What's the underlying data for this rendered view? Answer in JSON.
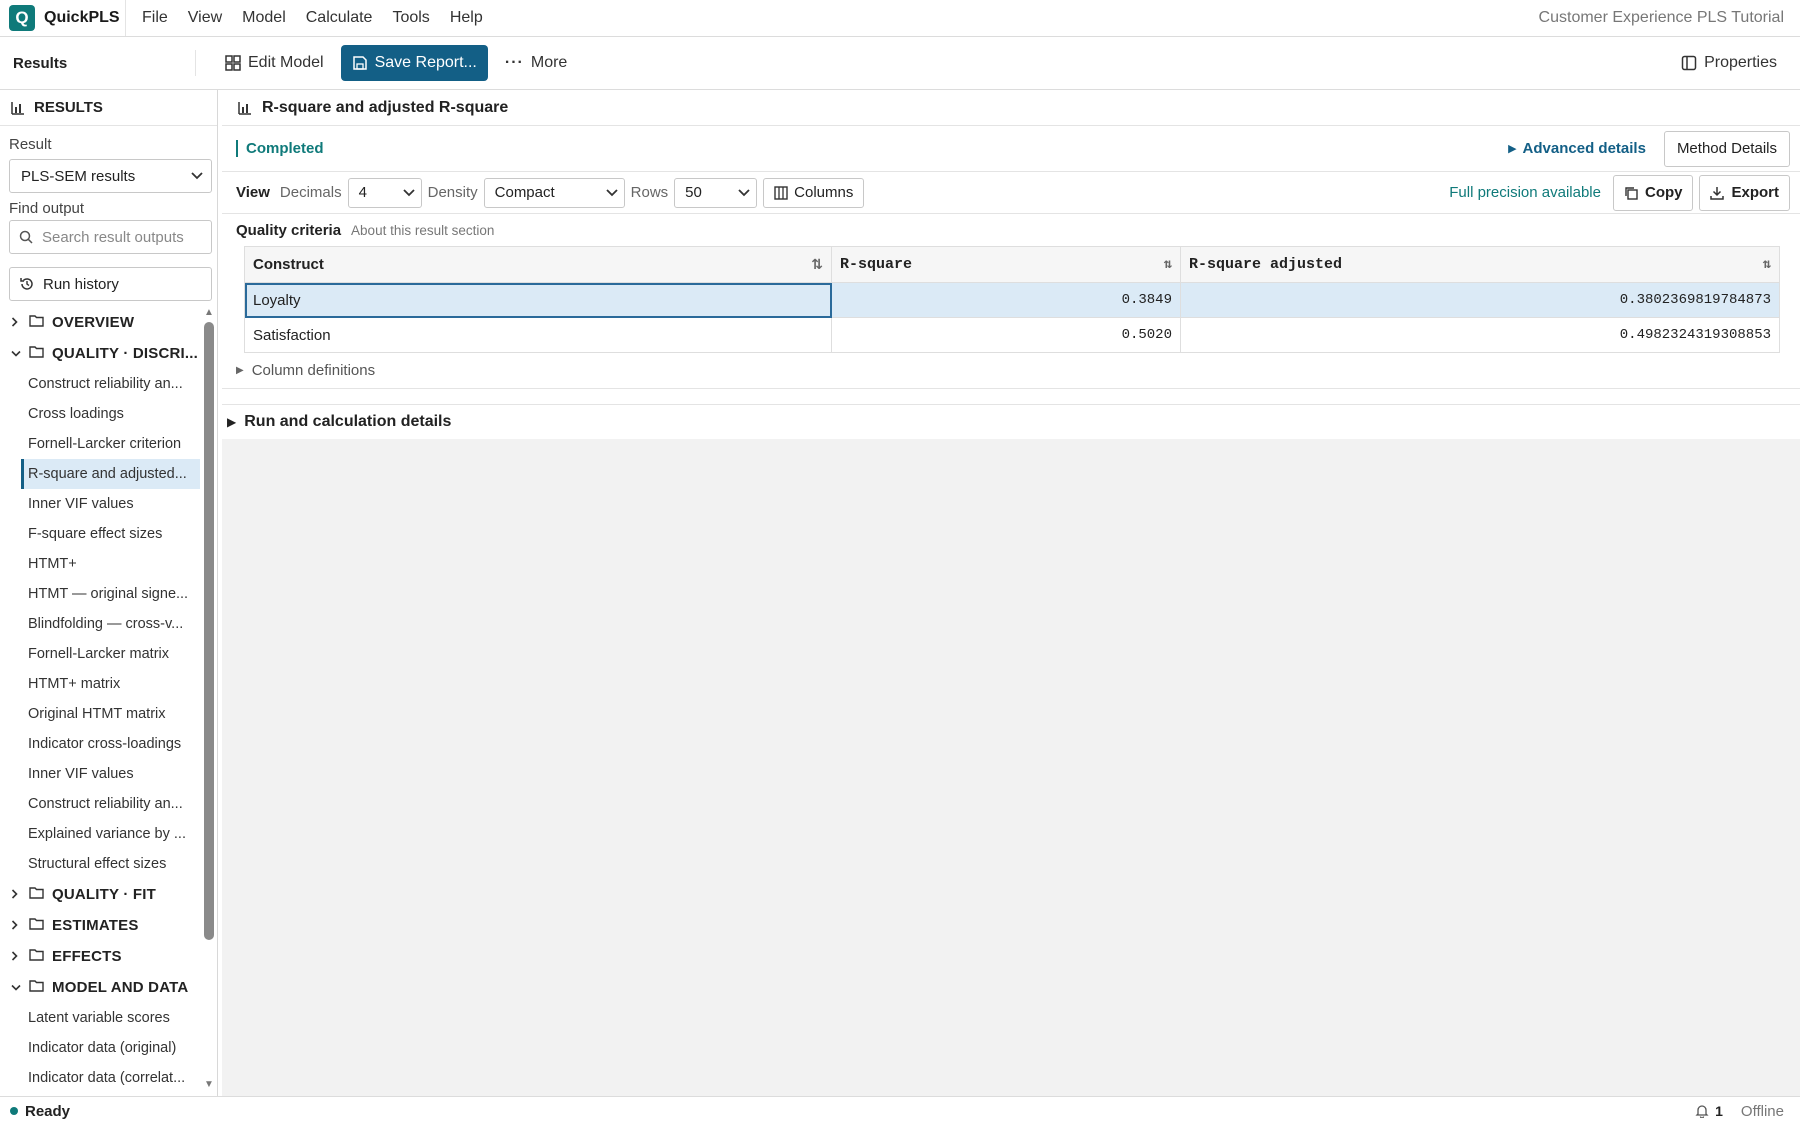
{
  "app": {
    "logo_letter": "Q",
    "name": "QuickPLS",
    "document_title": "Customer Experience PLS Tutorial"
  },
  "menu": [
    "File",
    "View",
    "Model",
    "Calculate",
    "Tools",
    "Help"
  ],
  "toolbar": {
    "section": "Results",
    "edit_model": "Edit Model",
    "save_report": "Save Report...",
    "more": "More",
    "properties": "Properties"
  },
  "sidebar": {
    "header": "RESULTS",
    "result_label": "Result",
    "result_value": "PLS-SEM results",
    "find_label": "Find output",
    "find_placeholder": "Search result outputs",
    "run_history": "Run history",
    "tree": [
      {
        "type": "folder",
        "label": "OVERVIEW",
        "expanded": false
      },
      {
        "type": "folder",
        "label": "QUALITY · DISCRI...",
        "expanded": true
      },
      {
        "type": "item",
        "label": "Construct reliability an..."
      },
      {
        "type": "item",
        "label": "Cross loadings"
      },
      {
        "type": "item",
        "label": "Fornell-Larcker criterion"
      },
      {
        "type": "item",
        "label": "R-square and adjusted...",
        "selected": true
      },
      {
        "type": "item",
        "label": "Inner VIF values"
      },
      {
        "type": "item",
        "label": "F-square effect sizes"
      },
      {
        "type": "item",
        "label": "HTMT+"
      },
      {
        "type": "item",
        "label": "HTMT — original signe..."
      },
      {
        "type": "item",
        "label": "Blindfolding — cross-v..."
      },
      {
        "type": "item",
        "label": "Fornell-Larcker matrix"
      },
      {
        "type": "item",
        "label": "HTMT+ matrix"
      },
      {
        "type": "item",
        "label": "Original HTMT matrix"
      },
      {
        "type": "item",
        "label": "Indicator cross-loadings"
      },
      {
        "type": "item",
        "label": "Inner VIF values"
      },
      {
        "type": "item",
        "label": "Construct reliability an..."
      },
      {
        "type": "item",
        "label": "Explained variance by ..."
      },
      {
        "type": "item",
        "label": "Structural effect sizes"
      },
      {
        "type": "folder",
        "label": "QUALITY · FIT",
        "expanded": false
      },
      {
        "type": "folder",
        "label": "ESTIMATES",
        "expanded": false
      },
      {
        "type": "folder",
        "label": "EFFECTS",
        "expanded": false
      },
      {
        "type": "folder",
        "label": "MODEL AND DATA",
        "expanded": true
      },
      {
        "type": "item",
        "label": "Latent variable scores"
      },
      {
        "type": "item",
        "label": "Indicator data (original)"
      },
      {
        "type": "item",
        "label": "Indicator data (correlat..."
      }
    ]
  },
  "main": {
    "title": "R-square and adjusted R-square",
    "status": "Completed",
    "advanced_details": "Advanced details",
    "method_details": "Method Details",
    "view_label": "View",
    "decimals_label": "Decimals",
    "decimals_value": "4",
    "density_label": "Density",
    "density_value": "Compact",
    "rows_label": "Rows",
    "rows_value": "50",
    "columns_btn": "Columns",
    "full_precision": "Full precision available",
    "copy": "Copy",
    "export": "Export",
    "section_title": "Quality criteria",
    "section_link": "About this result section",
    "table": {
      "headers": [
        "Construct",
        "R-square",
        "R-square adjusted"
      ],
      "rows": [
        [
          "Loyalty",
          "0.3849",
          "0.3802369819784873"
        ],
        [
          "Satisfaction",
          "0.5020",
          "0.4982324319308853"
        ]
      ]
    },
    "column_definitions": "Column definitions",
    "run_details": "Run and calculation details"
  },
  "statusbar": {
    "status": "Ready",
    "notifications": "1",
    "connection": "Offline"
  },
  "colors": {
    "accent": "#135f86",
    "brand": "#0f7a7a",
    "selection": "#dbeaf6"
  }
}
